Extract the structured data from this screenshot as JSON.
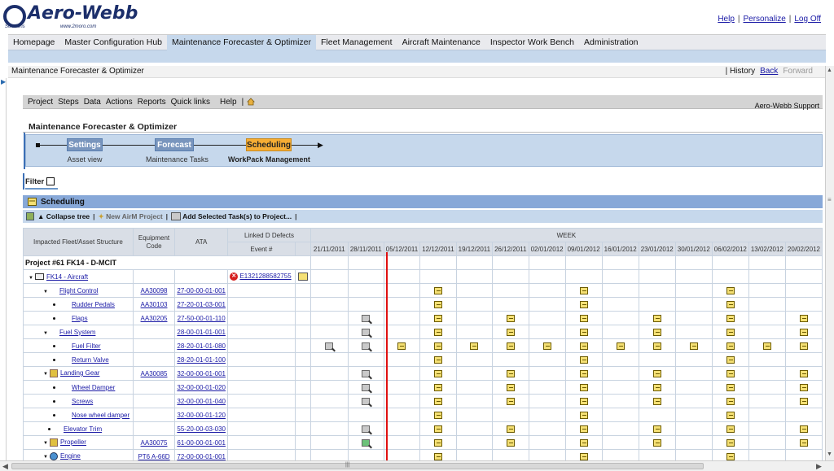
{
  "header": {
    "logo_text": "Aero-Webb",
    "logo_sub_left": "Solutions",
    "logo_sub_url": "www.2moro.com",
    "links": [
      "Help",
      "Personalize",
      "Log Off"
    ]
  },
  "nav": {
    "items": [
      "Homepage",
      "Master Configuration Hub",
      "Maintenance Forecaster & Optimizer",
      "Fleet Management",
      "Aircraft Maintenance",
      "Inspector Work Bench",
      "Administration"
    ],
    "active_index": 2
  },
  "page": {
    "title": "Maintenance Forecaster & Optimizer",
    "history": "History",
    "back": "Back",
    "forward": "Forward"
  },
  "menubar": {
    "items": [
      "Project",
      "Steps",
      "Data",
      "Actions",
      "Reports",
      "Quick links",
      "Help"
    ],
    "sep": "|",
    "support": "Aero-Webb Support"
  },
  "panel_title": "Maintenance Forecaster & Optimizer",
  "steps": [
    {
      "label": "Settings",
      "sub": "Asset view"
    },
    {
      "label": "Forecast",
      "sub": "Maintenance Tasks"
    },
    {
      "label": "Scheduling",
      "sub": "WorkPack Management"
    }
  ],
  "filter_label": "Filter",
  "scheduling_label": "Scheduling",
  "toolbar": {
    "collapse": "Collapse tree",
    "new_project": "New AirM Project",
    "add_selected": "Add Selected Task(s) to Project..."
  },
  "grid": {
    "headers": {
      "structure": "Impacted Fleet/Asset Structure",
      "equipment": "Equipment Code",
      "ata": "ATA",
      "linked": "Linked D Defects",
      "event": "Event #",
      "week": "WEEK"
    },
    "weeks": [
      "21/11/2011",
      "28/11/2011",
      "05/12/2011",
      "12/12/2011",
      "19/12/2011",
      "26/12/2011",
      "02/01/2012",
      "09/01/2012",
      "16/01/2012",
      "23/01/2012",
      "30/01/2012",
      "06/02/2012",
      "13/02/2012",
      "20/02/2012"
    ],
    "project_title": "Project #61 FK14 - D-MCIT",
    "rows": [
      {
        "name": "FK14 - Aircraft",
        "kind": "aircraft",
        "equip": "",
        "ata": "",
        "event": "E1321288582755",
        "cells": [
          "",
          "",
          "",
          "",
          "",
          "",
          "",
          "",
          "",
          "",
          "",
          "",
          "",
          ""
        ]
      },
      {
        "name": "Flight Control",
        "kind": "group",
        "equip": "AA30098",
        "ata": "27-00-00-01-001",
        "event": "",
        "cells": [
          "",
          "",
          "",
          "n",
          "",
          "",
          "",
          "n",
          "",
          "",
          "",
          "n",
          "",
          ""
        ]
      },
      {
        "name": "Rudder Pedals",
        "kind": "leaf",
        "equip": "AA30103",
        "ata": "27-20-01-03-001",
        "event": "",
        "cells": [
          "",
          "",
          "",
          "n",
          "",
          "",
          "",
          "n",
          "",
          "",
          "",
          "n",
          "",
          ""
        ]
      },
      {
        "name": "Flaps",
        "kind": "leaf",
        "equip": "AA30205",
        "ata": "27-50-00-01-110",
        "event": "",
        "cells": [
          "",
          "m",
          "",
          "n",
          "",
          "n",
          "",
          "n",
          "",
          "n",
          "",
          "n",
          "",
          "n"
        ]
      },
      {
        "name": "Fuel System",
        "kind": "group",
        "equip": "",
        "ata": "28-00-01-01-001",
        "event": "",
        "cells": [
          "",
          "m",
          "",
          "n",
          "",
          "n",
          "",
          "n",
          "",
          "n",
          "",
          "n",
          "",
          "n"
        ]
      },
      {
        "name": "Fuel Filter",
        "kind": "leaf",
        "equip": "",
        "ata": "28-20-01-01-080",
        "event": "",
        "cells": [
          "m",
          "m",
          "n",
          "n",
          "n",
          "n",
          "n",
          "n",
          "n",
          "n",
          "n",
          "n",
          "n",
          "n"
        ]
      },
      {
        "name": "Return Valve",
        "kind": "leaf",
        "equip": "",
        "ata": "28-20-01-01-100",
        "event": "",
        "cells": [
          "",
          "",
          "",
          "n",
          "",
          "",
          "",
          "n",
          "",
          "",
          "",
          "n",
          "",
          ""
        ]
      },
      {
        "name": "Landing Gear",
        "kind": "gear",
        "equip": "AA30085",
        "ata": "32-00-00-01-001",
        "event": "",
        "cells": [
          "",
          "m",
          "",
          "n",
          "",
          "n",
          "",
          "n",
          "",
          "n",
          "",
          "n",
          "",
          "n"
        ]
      },
      {
        "name": "Wheel Damper",
        "kind": "leaf",
        "equip": "",
        "ata": "32-00-00-01-020",
        "event": "",
        "cells": [
          "",
          "m",
          "",
          "n",
          "",
          "n",
          "",
          "n",
          "",
          "n",
          "",
          "n",
          "",
          "n"
        ]
      },
      {
        "name": "Screws",
        "kind": "leaf",
        "equip": "",
        "ata": "32-00-00-01-040",
        "event": "",
        "cells": [
          "",
          "m",
          "",
          "n",
          "",
          "n",
          "",
          "n",
          "",
          "n",
          "",
          "n",
          "",
          "n"
        ]
      },
      {
        "name": "Nose wheel damper",
        "kind": "leaf",
        "equip": "",
        "ata": "32-00-00-01-120",
        "event": "",
        "cells": [
          "",
          "",
          "",
          "n",
          "",
          "",
          "",
          "n",
          "",
          "",
          "",
          "n",
          "",
          ""
        ]
      },
      {
        "name": "Elevator Trim",
        "kind": "single",
        "equip": "",
        "ata": "55-20-00-03-030",
        "event": "",
        "cells": [
          "",
          "m",
          "",
          "n",
          "",
          "n",
          "",
          "n",
          "",
          "n",
          "",
          "n",
          "",
          "n"
        ]
      },
      {
        "name": "Propeller",
        "kind": "gear",
        "equip": "AA30075",
        "ata": "61-00-00-01-001",
        "event": "",
        "cells": [
          "",
          "g",
          "",
          "n",
          "",
          "n",
          "",
          "n",
          "",
          "n",
          "",
          "n",
          "",
          "n"
        ]
      },
      {
        "name": "Engine",
        "kind": "engine",
        "equip": "PT6 A-66D",
        "ata": "72-00-00-01-001",
        "event": "",
        "cells": [
          "",
          "",
          "",
          "n",
          "",
          "",
          "",
          "n",
          "",
          "",
          "",
          "n",
          "",
          ""
        ]
      }
    ]
  }
}
